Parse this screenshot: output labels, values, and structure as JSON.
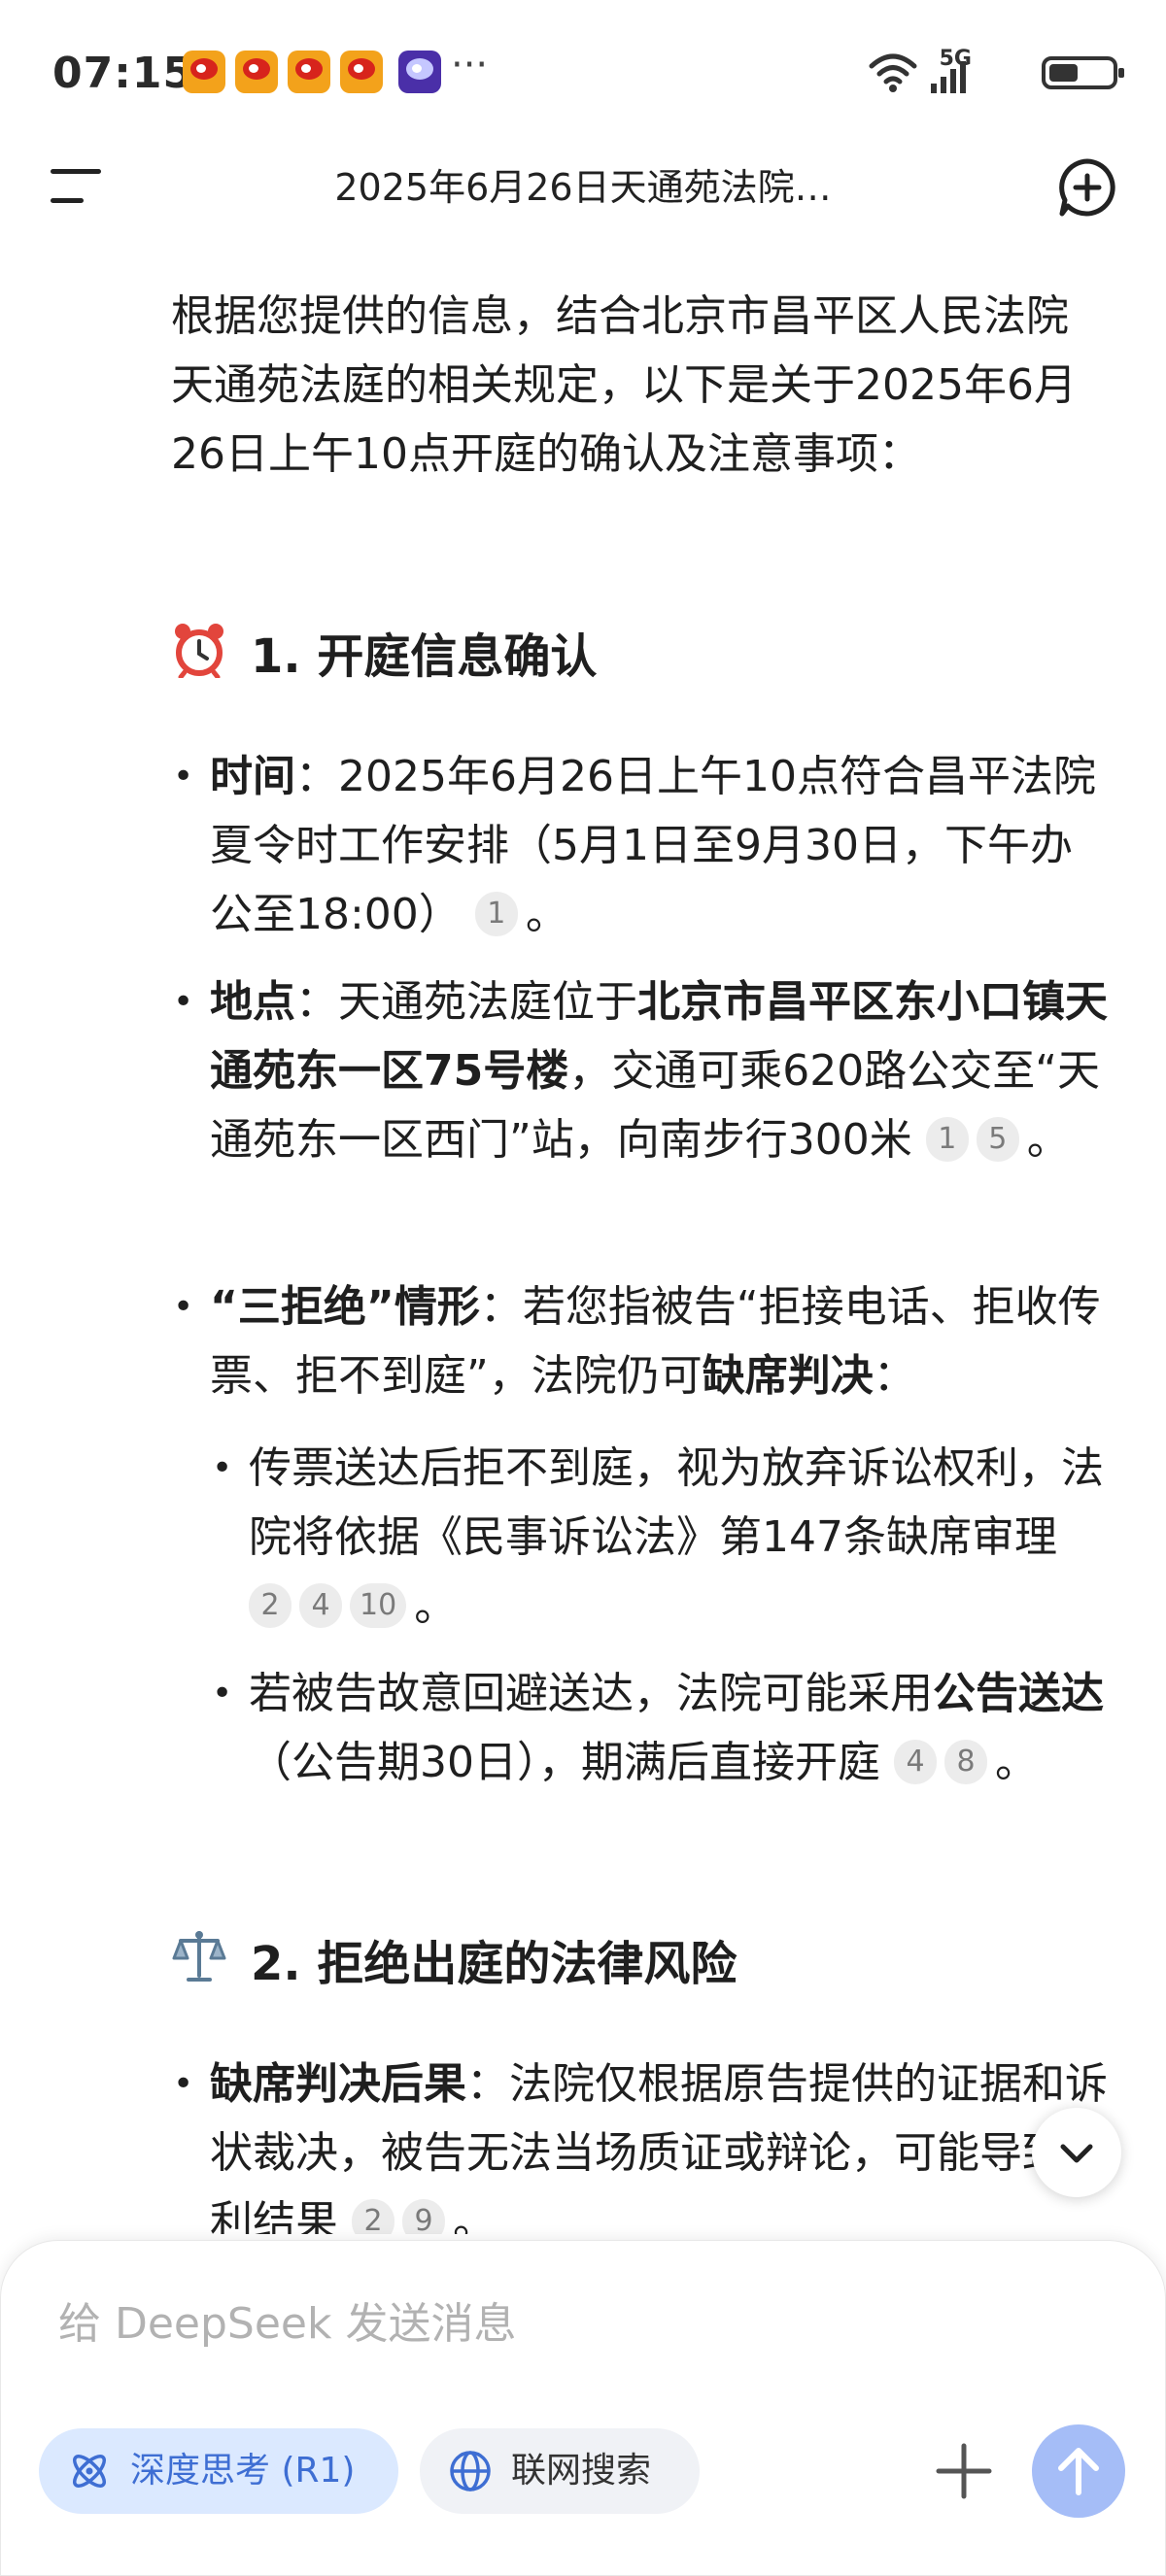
{
  "status_bar": {
    "time": "07:15",
    "network": "5G",
    "battery_level": 0.42,
    "notification_icons": [
      "weibo-icon",
      "weibo-icon",
      "weibo-icon",
      "weibo-icon",
      "app-notification-icon"
    ]
  },
  "header": {
    "title": "2025年6月26日天通苑法院…"
  },
  "message": {
    "intro": "根据您提供的信息，结合北京市昌平区人民法院天通苑法庭的相关规定，以下是关于2025年6月26日上午10点开庭的确认及注意事项：",
    "section1": {
      "title": "1. 开庭信息确认",
      "icon": "alarm-clock-icon",
      "time_item": {
        "label": "时间",
        "text": "：2025年6月26日上午10点符合昌平法院夏令时工作安排（5月1日至9月30日，下午办公至18:00）",
        "cites": [
          "1"
        ],
        "end": "。"
      },
      "location_item": {
        "label": "地点",
        "text1": "：天通苑法庭位于",
        "bold": "北京市昌平区东小口镇天通苑东一区75号楼",
        "text2": "，交通可乘620路公交至“天通苑东一区西门”站，向南步行300米",
        "cites": [
          "1",
          "5"
        ],
        "end": "。"
      },
      "refuse_item": {
        "label": "“三拒绝”情形",
        "text1": "：若您指被告“拒接电话、拒收传票、拒不到庭”，法院仍可",
        "bold": "缺席判决",
        "text2": "："
      },
      "sub1": {
        "text": "传票送达后拒不到庭，视为放弃诉讼权利，法院将依据《民事诉讼法》第147条缺席审理",
        "cites": [
          "2",
          "4",
          "10"
        ],
        "end": "。"
      },
      "sub2": {
        "text1": "若被告故意回避送达，法院可能采用",
        "bold": "公告送达",
        "text2": "（公告期30日），期满后直接开庭",
        "cites": [
          "4",
          "8"
        ],
        "end": "。"
      }
    },
    "section2": {
      "title": "2. 拒绝出庭的法律风险",
      "icon": "balance-scale-icon",
      "item1": {
        "label": "缺席判决后果",
        "text": "：法院仅根据原告提供的证据和诉状裁决，被告无法当场质证或辩论，可能导致不利结果",
        "cites": [
          "2",
          "9"
        ],
        "end": "。"
      }
    }
  },
  "composer": {
    "placeholder": "给 DeepSeek 发送消息",
    "deep_think_label": "深度思考 (R1)",
    "web_search_label": "联网搜索"
  },
  "colors": {
    "accent": "#3e6ed3",
    "pill_active_bg": "#dbe9ff",
    "send_button": "#a5bdf7",
    "citation_bg": "#ececec"
  }
}
